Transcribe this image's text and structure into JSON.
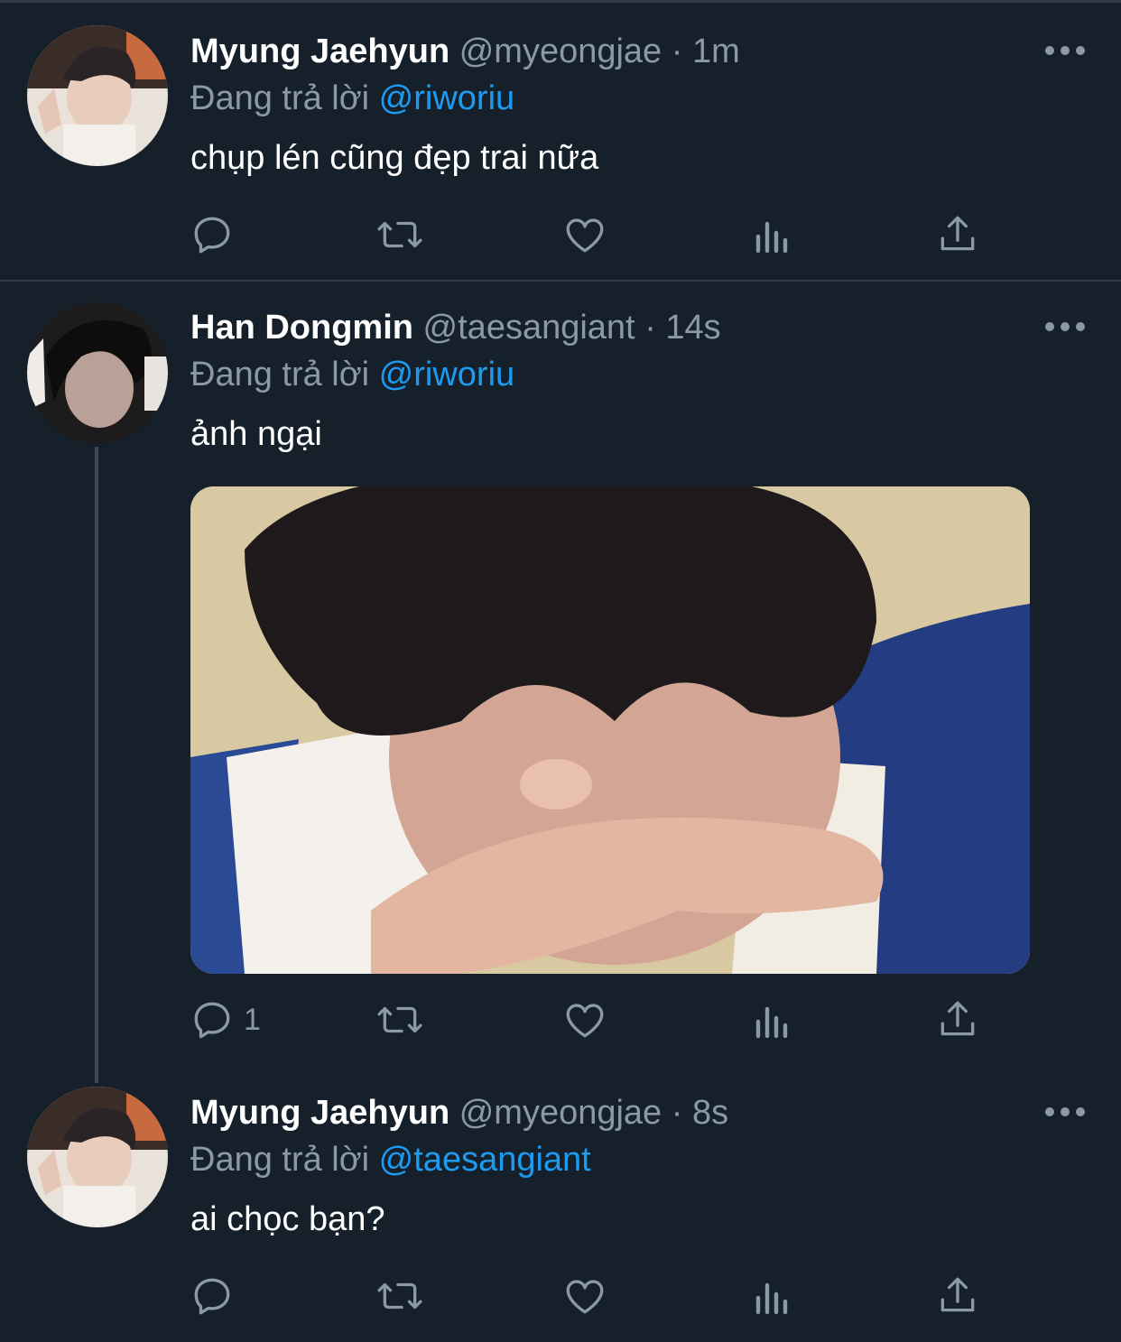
{
  "colors": {
    "background": "#15202b",
    "muted": "#8b98a5",
    "accent": "#1d9bf0",
    "divider": "#2f3b48"
  },
  "tweets": [
    {
      "author": "Myung Jaehyun",
      "handle": "@myeongjae",
      "separator": "·",
      "time": "1m",
      "replying_prefix": "Đang trả lời",
      "replying_to": "@riworiu",
      "text": "chụp lén cũng đẹp trai nữa",
      "reply_count": "",
      "avatar": "user-avatar-photo"
    },
    {
      "author": "Han Dongmin",
      "handle": "@taesangiant",
      "separator": "·",
      "time": "14s",
      "replying_prefix": "Đang trả lời",
      "replying_to": "@riworiu",
      "text": "ảnh ngại",
      "reply_count": "1",
      "avatar": "user-avatar-photo",
      "media": "attached-photo"
    },
    {
      "author": "Myung Jaehyun",
      "handle": "@myeongjae",
      "separator": "·",
      "time": "8s",
      "replying_prefix": "Đang trả lời",
      "replying_to": "@taesangiant",
      "text": "ai chọc bạn?",
      "reply_count": "",
      "avatar": "user-avatar-photo"
    }
  ],
  "icons": {
    "reply": "reply-icon",
    "retweet": "retweet-icon",
    "like": "heart-icon",
    "stats": "analytics-icon",
    "share": "share-icon",
    "more": "more-icon"
  }
}
